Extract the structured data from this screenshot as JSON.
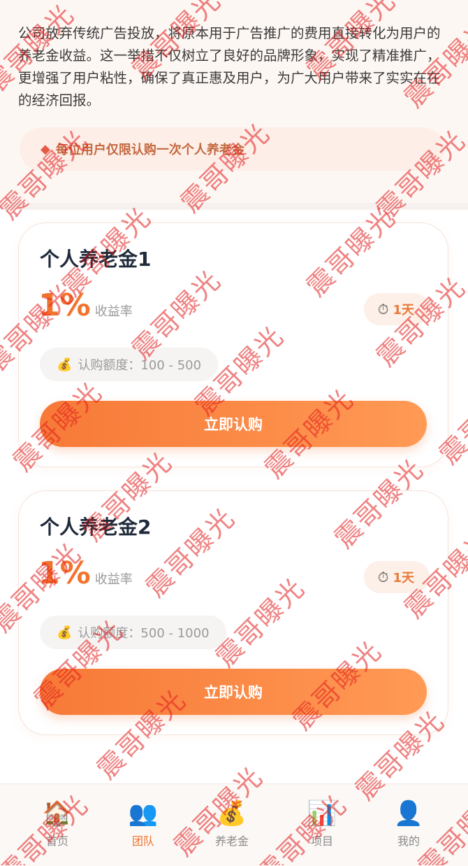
{
  "intro": {
    "text": "公司放弃传统广告投放，将原本用于广告推广的费用直接转化为用户的养老金收益。这一举措不仅树立了良好的品牌形象，实现了精准推广，更增强了用户粘性，确保了真正惠及用户，为广大用户带来了实实在在的经济回报。",
    "notice": "每位用户仅限认购一次个人养老金"
  },
  "products": [
    {
      "title": "个人养老金1",
      "rate": "1%",
      "rate_label": "收益率",
      "term": "1天",
      "amount": "认购额度：100 - 500",
      "button": "立即认购"
    },
    {
      "title": "个人养老金2",
      "rate": "1%",
      "rate_label": "收益率",
      "term": "1天",
      "amount": "认购额度：500 - 1000",
      "button": "立即认购"
    }
  ],
  "tabs": [
    {
      "label": "首页",
      "icon": "house-icon",
      "glyph": "🏠"
    },
    {
      "label": "团队",
      "icon": "team-icon",
      "glyph": "👥"
    },
    {
      "label": "养老金",
      "icon": "money-bag-icon",
      "glyph": "💰"
    },
    {
      "label": "项目",
      "icon": "bar-chart-icon",
      "glyph": "📊"
    },
    {
      "label": "我的",
      "icon": "user-icon",
      "glyph": "👤"
    }
  ],
  "watermark": "震哥曝光",
  "colors": {
    "accent": "#f2732e",
    "button_start": "#f77937",
    "button_end": "#ff9a55",
    "title": "#1f2a3a"
  }
}
